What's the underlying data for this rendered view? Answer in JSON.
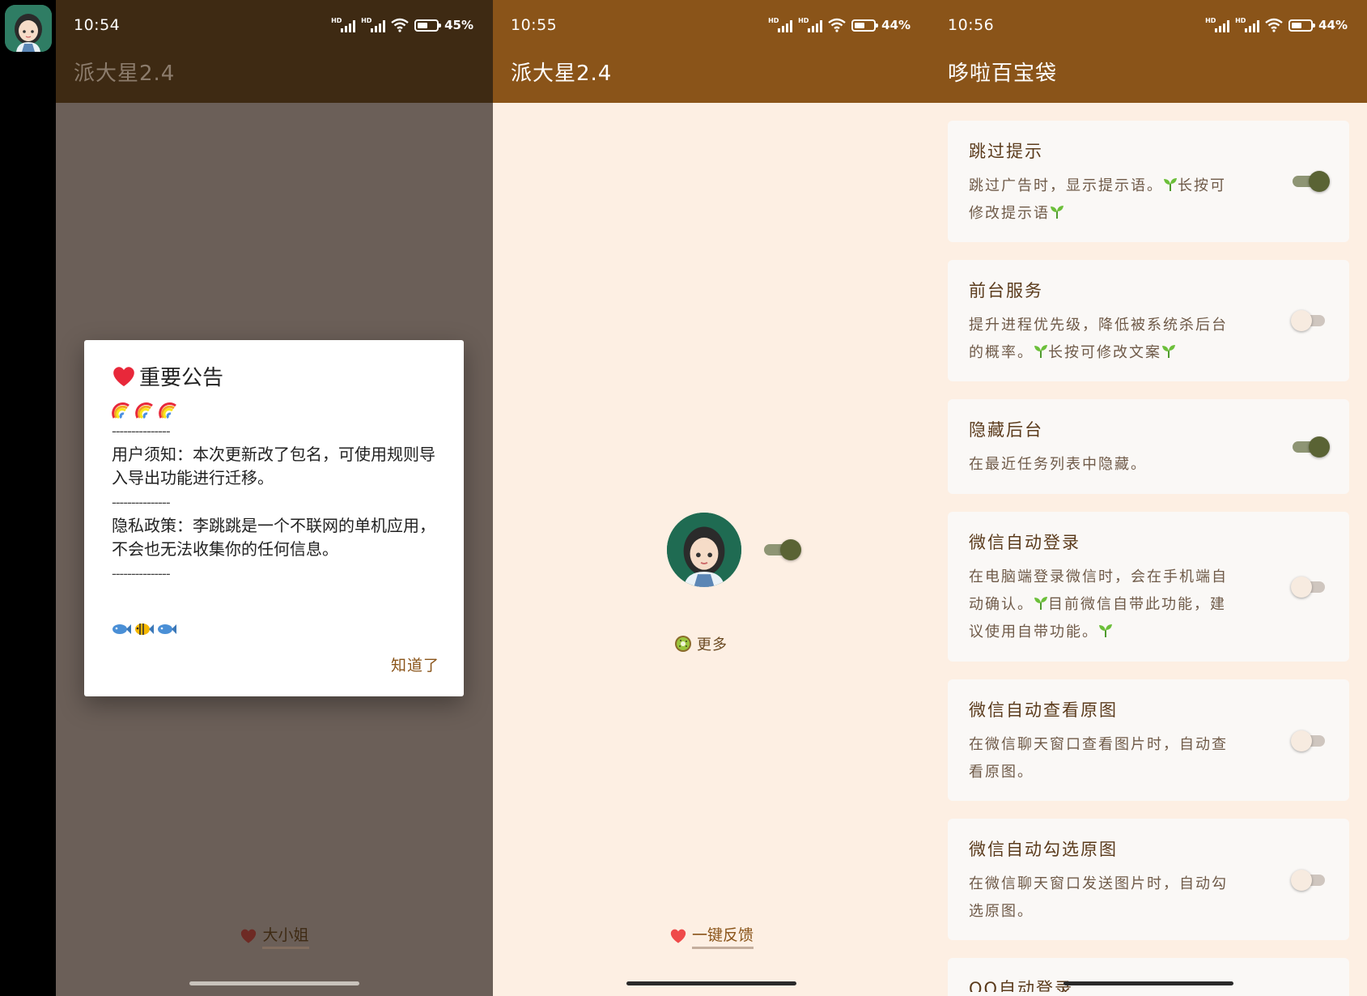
{
  "panel1": {
    "time": "10:54",
    "battery": "45%",
    "battery_level": 0.45,
    "title": "派大星2.4",
    "dialog": {
      "title": "重要公告",
      "dash": "---------------",
      "notice": "用户须知：本次更新改了包名，可使用规则导入导出功能进行迁移。",
      "privacy": "隐私政策：李跳跳是一个不联网的单机应用，不会也无法收集你的任何信息。",
      "ok": "知道了"
    },
    "bottom_link": "大小姐"
  },
  "panel2": {
    "time": "10:55",
    "battery": "44%",
    "battery_level": 0.44,
    "title": "派大星2.4",
    "main_toggle": true,
    "more": "更多",
    "bottom_link": "一键反馈"
  },
  "panel3": {
    "time": "10:56",
    "battery": "44%",
    "battery_level": 0.44,
    "title": "哆啦百宝袋",
    "items": [
      {
        "title": "跳过提示",
        "desc_lines": [
          "跳过广告时，显示提示语。",
          "长按可",
          "修改提示语"
        ],
        "on": true
      },
      {
        "title": "前台服务",
        "desc_lines": [
          "提升进程优先级，降低被系统杀后台",
          "的概率。",
          "长按可修改文案"
        ],
        "on": false
      },
      {
        "title": "隐藏后台",
        "desc_lines": [
          "在最近任务列表中隐藏。"
        ],
        "on": true
      },
      {
        "title": "微信自动登录",
        "desc_lines": [
          "在电脑端登录微信时，会在手机端自",
          "动确认。",
          "目前微信自带此功能，建",
          "议使用自带功能。"
        ],
        "on": false
      },
      {
        "title": "微信自动查看原图",
        "desc_lines": [
          "在微信聊天窗口查看图片时，自动查",
          "看原图。"
        ],
        "on": false
      },
      {
        "title": "微信自动勾选原图",
        "desc_lines": [
          "在微信聊天窗口发送图片时，自动勾",
          "选原图。"
        ],
        "on": false
      }
    ],
    "partial_item": "QQ自动登录"
  }
}
